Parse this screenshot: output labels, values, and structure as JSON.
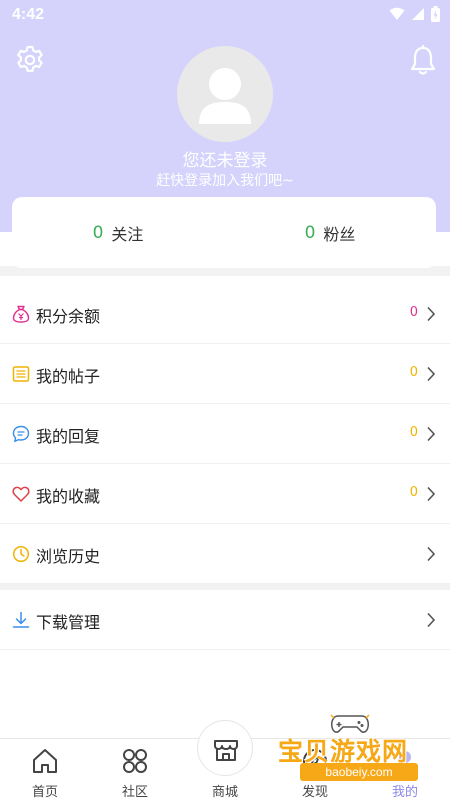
{
  "status_bar": {
    "time": "4:42"
  },
  "profile": {
    "title": "您还未登录",
    "subtitle": "赶快登录加入我们吧~"
  },
  "stats": [
    {
      "count": "0",
      "label": "关注"
    },
    {
      "count": "0",
      "label": "粉丝"
    }
  ],
  "menu": {
    "items": [
      {
        "label": "积分余额",
        "count": "0",
        "count_color": "#e0318f",
        "icon": "points-money-bag-icon",
        "icon_color": "#e0318f"
      },
      {
        "label": "我的帖子",
        "count": "0",
        "count_color": "#f0b400",
        "icon": "posts-icon",
        "icon_color": "#f0b400"
      },
      {
        "label": "我的回复",
        "count": "0",
        "count_color": "#f0b400",
        "icon": "reply-chat-icon",
        "icon_color": "#3a8ee6"
      },
      {
        "label": "我的收藏",
        "count": "0",
        "count_color": "#f0b400",
        "icon": "heart-icon",
        "icon_color": "#e0404a"
      },
      {
        "label": "浏览历史",
        "icon": "clock-icon",
        "icon_color": "#f0b400"
      }
    ],
    "extra": [
      {
        "label": "下载管理",
        "icon": "download-icon",
        "icon_color": "#3a8ee6"
      }
    ]
  },
  "bottom_nav": {
    "items": [
      {
        "label": "首页",
        "icon": "home-icon"
      },
      {
        "label": "社区",
        "icon": "community-grid-icon"
      },
      {
        "label": "商城",
        "icon": "store-icon"
      },
      {
        "label": "发现",
        "icon": "discover-icon"
      },
      {
        "label": "我的",
        "icon": "profile-icon"
      }
    ]
  },
  "watermark": {
    "title": "宝贝游戏网",
    "url": "baobeiy.com"
  },
  "colors": {
    "header_bg": "#d5d3fb",
    "accent_green": "#3daf5b",
    "watermark": "#f6a817"
  }
}
